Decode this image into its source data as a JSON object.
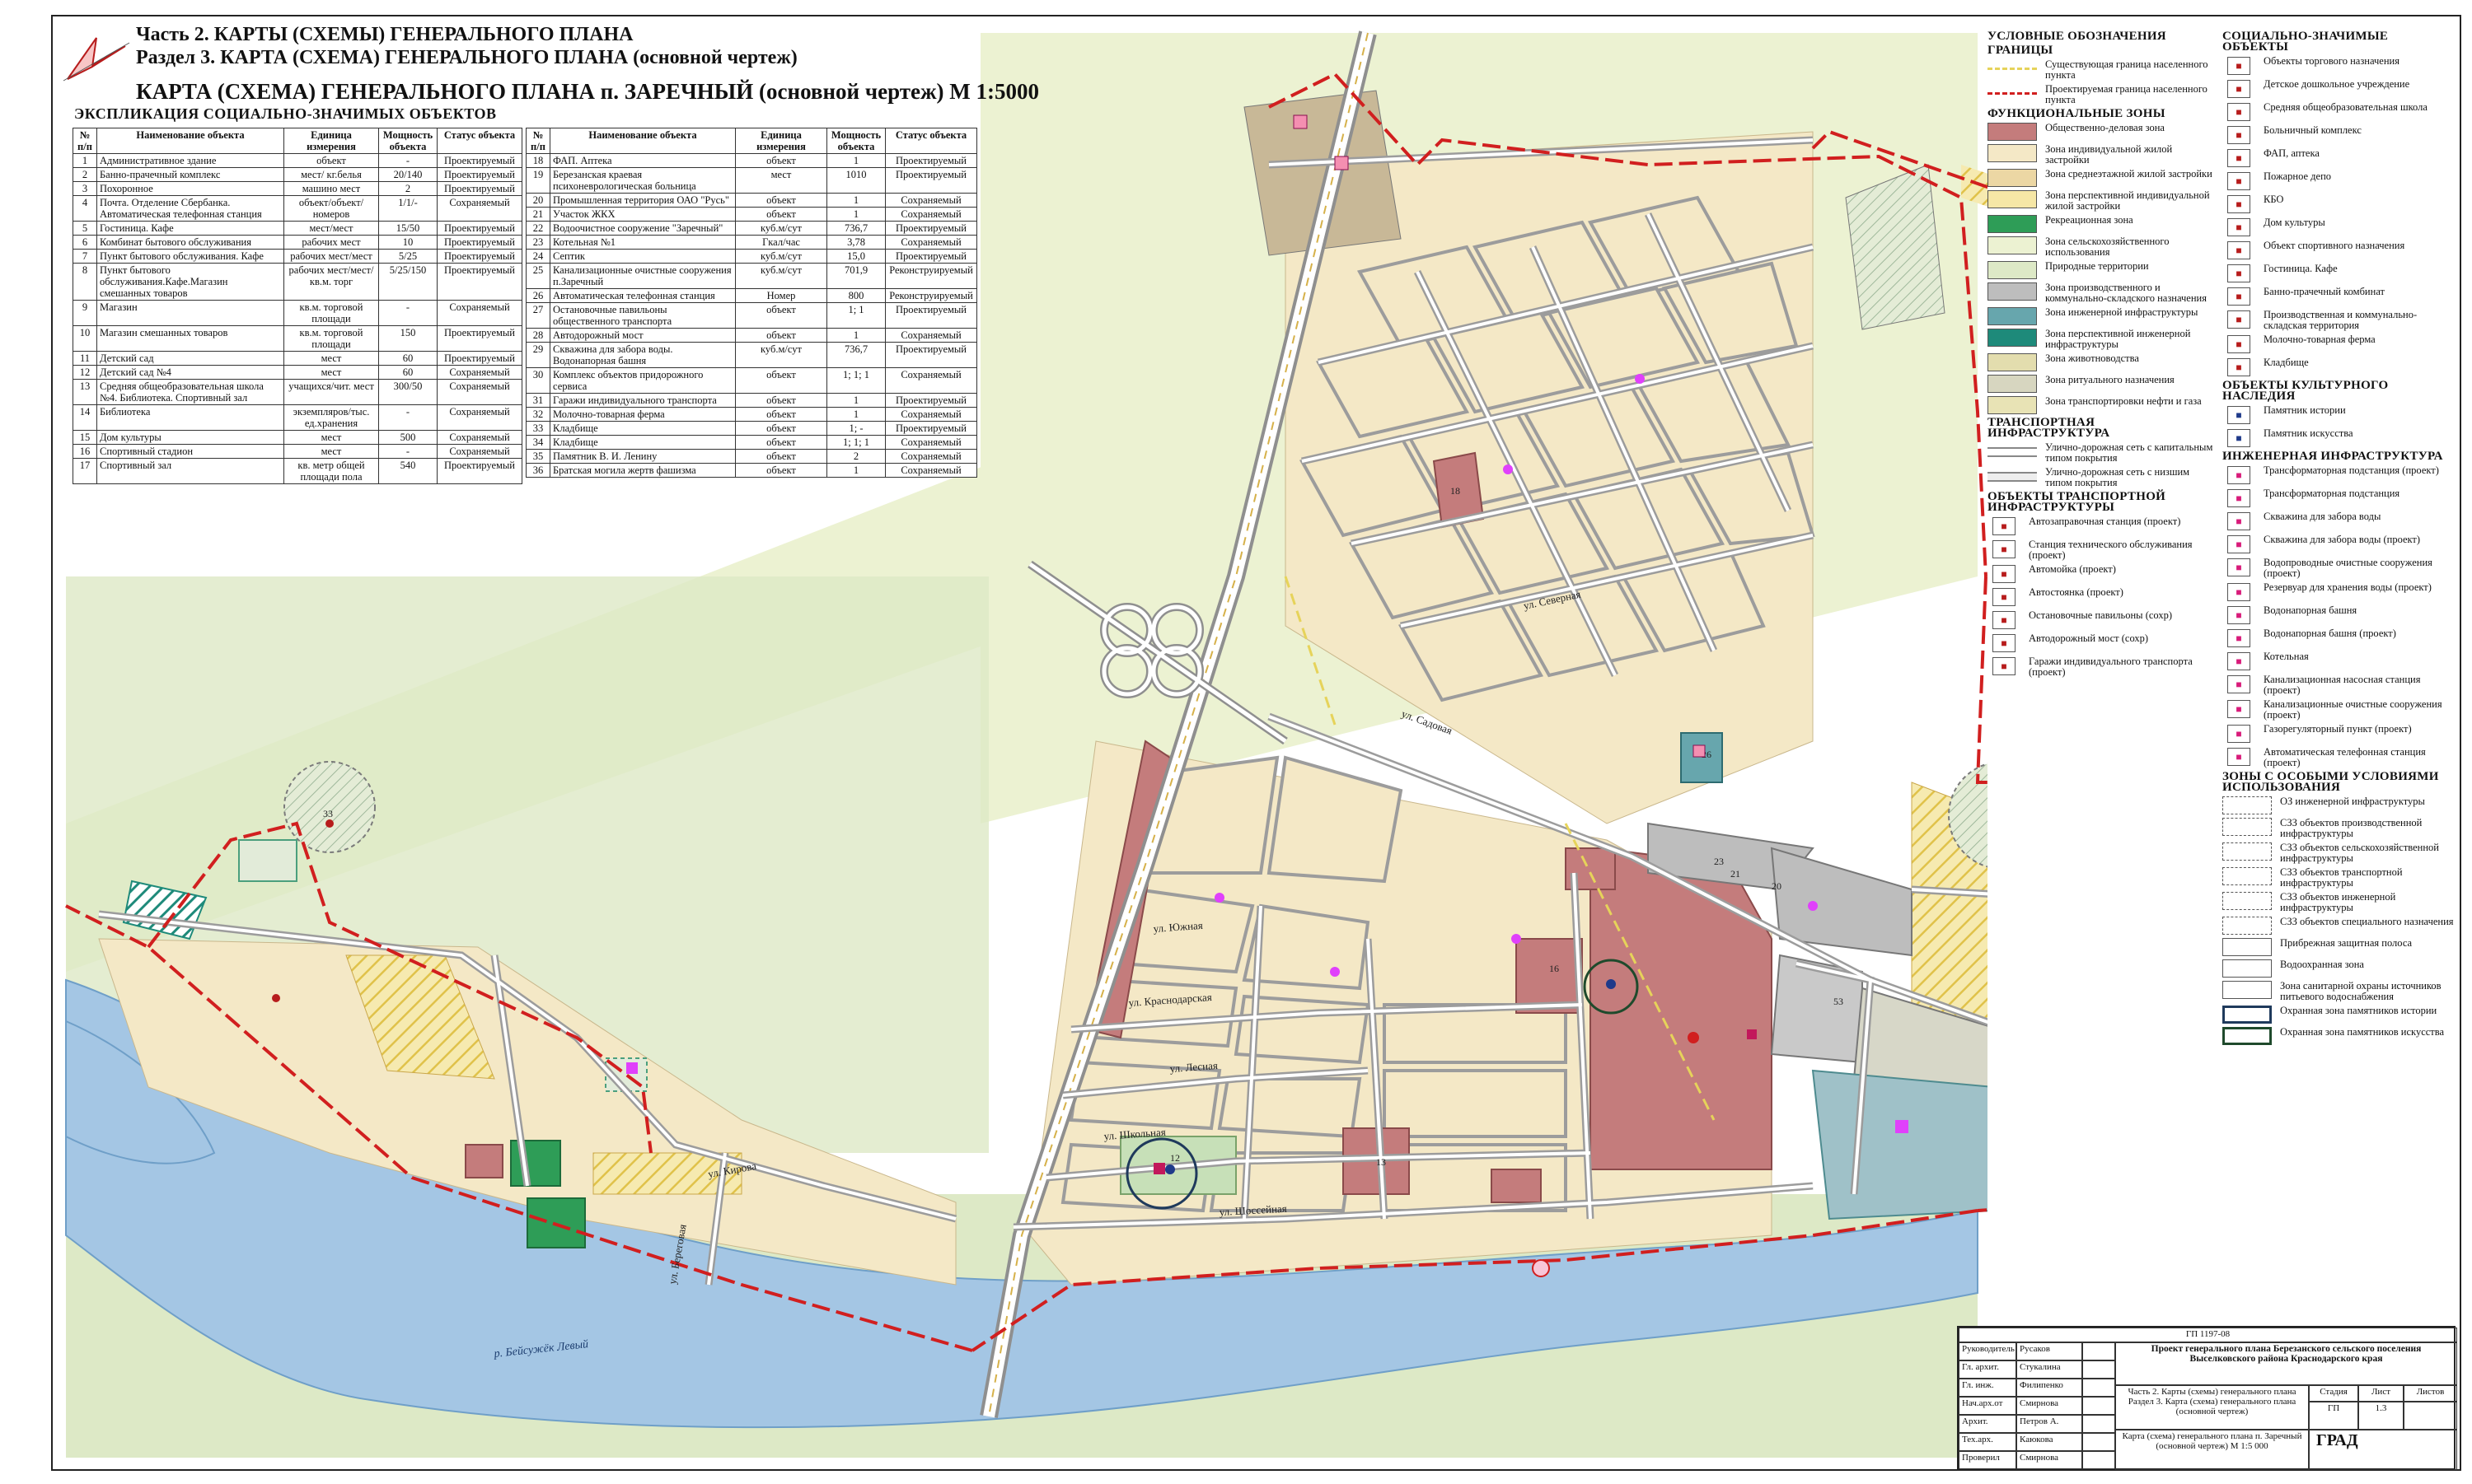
{
  "titles": {
    "part": "Часть 2. КАРТЫ (СХЕМЫ) ГЕНЕРАЛЬНОГО ПЛАНА",
    "section": "Раздел 3. КАРТА (СХЕМА) ГЕНЕРАЛЬНОГО ПЛАНА (основной чертеж)",
    "map": "КАРТА (СХЕМА) ГЕНЕРАЛЬНОГО ПЛАНА п. ЗАРЕЧНЫЙ (основной чертеж)  М 1:5000"
  },
  "explication": {
    "title": "ЭКСПЛИКАЦИЯ СОЦИАЛЬНО-ЗНАЧИМЫХ ОБЪЕКТОВ",
    "headers": [
      "№ п/п",
      "Наименование объекта",
      "Единица измерения",
      "Мощность объекта",
      "Статус объекта"
    ],
    "rows_left": [
      [
        "1",
        "Административное здание",
        "объект",
        "-",
        "Проектируемый"
      ],
      [
        "2",
        "Банно-прачечный комплекс",
        "мест/ кг.белья",
        "20/140",
        "Проектируемый"
      ],
      [
        "3",
        "Похоронное",
        "машино мест",
        "2",
        "Проектируемый"
      ],
      [
        "4",
        "Почта. Отделение Сбербанка. Автоматическая телефонная станция",
        "объект/объект/номеров",
        "1/1/-",
        "Сохраняемый"
      ],
      [
        "5",
        "Гостиница. Кафе",
        "мест/мест",
        "15/50",
        "Проектируемый"
      ],
      [
        "6",
        "Комбинат бытового обслуживания",
        "рабочих мест",
        "10",
        "Проектируемый"
      ],
      [
        "7",
        "Пункт бытового обслуживания. Кафе",
        "рабочих мест/мест",
        "5/25",
        "Проектируемый"
      ],
      [
        "8",
        "Пункт бытового обслуживания.Кафе.Магазин смешанных товаров",
        "рабочих мест/мест/кв.м. торг",
        "5/25/150",
        "Проектируемый"
      ],
      [
        "9",
        "Магазин",
        "кв.м. торговой площади",
        "-",
        "Сохраняемый"
      ],
      [
        "10",
        "Магазин смешанных товаров",
        "кв.м. торговой площади",
        "150",
        "Проектируемый"
      ],
      [
        "11",
        "Детский сад",
        "мест",
        "60",
        "Проектируемый"
      ],
      [
        "12",
        "Детский сад №4",
        "мест",
        "60",
        "Сохраняемый"
      ],
      [
        "13",
        "Средняя общеобразовательная школа №4. Библиотека. Спортивный зал",
        "учащихся/чит. мест",
        "300/50",
        "Сохраняемый"
      ],
      [
        "14",
        "Библиотека",
        "экземпляров/тыс. ед.хранения",
        "-",
        "Сохраняемый"
      ],
      [
        "15",
        "Дом культуры",
        "мест",
        "500",
        "Сохраняемый"
      ],
      [
        "16",
        "Спортивный стадион",
        "мест",
        "-",
        "Сохраняемый"
      ],
      [
        "17",
        "Спортивный зал",
        "кв. метр общей площади пола",
        "540",
        "Проектируемый"
      ]
    ],
    "rows_right": [
      [
        "18",
        "ФАП. Аптека",
        "объект",
        "1",
        "Проектируемый"
      ],
      [
        "19",
        "Березанская краевая психоневрологическая больница",
        "мест",
        "1010",
        "Проектируемый"
      ],
      [
        "20",
        "Промышленная территория ОАО \"Русь\"",
        "объект",
        "1",
        "Сохраняемый"
      ],
      [
        "21",
        "Участок ЖКХ",
        "объект",
        "1",
        "Сохраняемый"
      ],
      [
        "22",
        "Водоочистное сооружение \"Заречный\"",
        "куб.м/сут",
        "736,7",
        "Проектируемый"
      ],
      [
        "23",
        "Котельная №1",
        "Гкал/час",
        "3,78",
        "Сохраняемый"
      ],
      [
        "24",
        "Септик",
        "куб.м/сут",
        "15,0",
        "Проектируемый"
      ],
      [
        "25",
        "Канализационные очистные сооружения п.Заречный",
        "куб.м/сут",
        "701,9",
        "Реконструируемый"
      ],
      [
        "26",
        "Автоматическая телефонная станция",
        "Номер",
        "800",
        "Реконструируемый"
      ],
      [
        "27",
        "Остановочные павильоны общественного транспорта",
        "объект",
        "1; 1",
        "Проектируемый"
      ],
      [
        "28",
        "Автодорожный мост",
        "объект",
        "1",
        "Сохраняемый"
      ],
      [
        "29",
        "Скважина для забора воды. Водонапорная башня",
        "куб.м/сут",
        "736,7",
        "Проектируемый"
      ],
      [
        "30",
        "Комплекс объектов придорожного сервиса",
        "объект",
        "1; 1; 1",
        "Сохраняемый"
      ],
      [
        "31",
        "Гаражи индивидуального транспорта",
        "объект",
        "1",
        "Проектируемый"
      ],
      [
        "32",
        "Молочно-товарная ферма",
        "объект",
        "1",
        "Сохраняемый"
      ],
      [
        "33",
        "Кладбище",
        "объект",
        "1; -",
        "Проектируемый"
      ],
      [
        "34",
        "Кладбище",
        "объект",
        "1; 1; 1",
        "Сохраняемый"
      ],
      [
        "35",
        "Памятник В. И. Ленину",
        "объект",
        "2",
        "Сохраняемый"
      ],
      [
        "36",
        "Братская могила жертв фашизма",
        "объект",
        "1",
        "Сохраняемый"
      ]
    ]
  },
  "map": {
    "river_label": "р. Бейсужёк Левый",
    "streets": [
      "ул. Южная",
      "ул. Краснодарская",
      "ул. Лесная",
      "ул. Школьная",
      "ул. Садовая",
      "ул. Шоссейная",
      "ул. Кирова",
      "ул. Береговая",
      "ул. Северная"
    ],
    "lot_numbers": [
      "33",
      "53",
      "52",
      "23",
      "21",
      "20",
      "19",
      "16",
      "13",
      "12",
      "18",
      "26"
    ],
    "colors": {
      "residential": "#f4e8c6",
      "midrise": "#ecd7a4",
      "public": "#c47c7c",
      "agri": "#ecf2d2",
      "natural": "#dde9c6",
      "water": "#a4c6e4",
      "production": "#bdbdbd",
      "boundary": "#d11f1f",
      "recreation": "#2e9d57",
      "engineering": "#67a6ad"
    }
  },
  "legend": {
    "title": "УСЛОВНЫЕ ОБОЗНАЧЕНИЯ",
    "boundaries_title": "ГРАНИЦЫ",
    "boundaries": [
      {
        "label": "Существующая граница населенного пункта",
        "color": "#e6d35a"
      },
      {
        "label": "Проектируемая граница населенного пункта",
        "color": "#d11f1f"
      }
    ],
    "zones_title": "ФУНКЦИОНАЛЬНЫЕ ЗОНЫ",
    "zones": [
      {
        "label": "Общественно-деловая зона",
        "color": "#c47c7c"
      },
      {
        "label": "Зона индивидуальной жилой застройки",
        "color": "#f4e8c6"
      },
      {
        "label": "Зона среднеэтажной жилой застройки",
        "color": "#ecd7a4"
      },
      {
        "label": "Зона перспективной индивидуальной жилой застройки",
        "color": "#f6e7a6"
      },
      {
        "label": "Рекреационная зона",
        "color": "#2e9d57"
      },
      {
        "label": "Зона сельскохозяйственного использования",
        "color": "#ecf2d2"
      },
      {
        "label": "Природные территории",
        "color": "#dde9c6"
      },
      {
        "label": "Зона производственного и коммунально-складского назначения",
        "color": "#bdbdbd"
      },
      {
        "label": "Зона инженерной инфраструктуры",
        "color": "#67a6ad"
      },
      {
        "label": "Зона перспективной инженерной инфраструктуры",
        "color": "#1e8a7a"
      },
      {
        "label": "Зона животноводства",
        "color": "#e3ddae"
      },
      {
        "label": "Зона ритуального назначения",
        "color": "#d7d6c0"
      },
      {
        "label": "Зона транспортировки нефти и газа",
        "color": "#e8e3b5"
      }
    ],
    "transport_title": "ТРАНСПОРТНАЯ ИНФРАСТРУКТУРА",
    "transport": [
      {
        "label": "Улично-дорожная сеть с капитальным типом покрытия"
      },
      {
        "label": "Улично-дорожная сеть с низшим типом покрытия"
      }
    ],
    "transport_objects_title": "ОБЪЕКТЫ ТРАНСПОРТНОЙ ИНФРАСТРУКТУРЫ",
    "transport_objects": [
      "Автозаправочная станция (проект)",
      "Станция технического обслуживания (проект)",
      "Автомойка (проект)",
      "Автостоянка (проект)",
      "Остановочные павильоны (сохр)",
      "Автодорожный мост (сохр)",
      "Гаражи индивидуального транспорта (проект)"
    ],
    "social_title": "СОЦИАЛЬНО-ЗНАЧИМЫЕ ОБЪЕКТЫ",
    "social": [
      "Объекты торгового назначения",
      "Детское дошкольное учреждение",
      "Средняя общеобразовательная школа",
      "Больничный комплекс",
      "ФАП, аптека",
      "Пожарное депо",
      "КБО",
      "Дом культуры",
      "Объект спортивного назначения",
      "Гостиница. Кафе",
      "Банно-прачечный комбинат",
      "Производственная и коммунально-складская территория",
      "Молочно-товарная ферма",
      "Кладбище"
    ],
    "heritage_title": "ОБЪЕКТЫ КУЛЬТУРНОГО НАСЛЕДИЯ",
    "heritage": [
      "Памятник истории",
      "Памятник искусства"
    ],
    "engineering_title": "ИНЖЕНЕРНАЯ ИНФРАСТРУКТУРА",
    "engineering": [
      "Трансформаторная подстанция (проект)",
      "Трансформаторная подстанция",
      "Скважина для забора воды",
      "Скважина для забора воды (проект)",
      "Водопроводные очистные сооружения (проект)",
      "Резервуар для хранения воды (проект)",
      "Водонапорная башня",
      "Водонапорная башня (проект)",
      "Котельная",
      "Канализационная насосная станция (проект)",
      "Канализационные очистные сооружения (проект)",
      "Газорегуляторный пункт (проект)",
      "Автоматическая телефонная станция (проект)"
    ],
    "special_title": "ЗОНЫ С ОСОБЫМИ УСЛОВИЯМИ ИСПОЛЬЗОВАНИЯ",
    "special": [
      "ОЗ инженерной инфраструктуры",
      "СЗЗ объектов производственной инфраструктуры",
      "СЗЗ объектов сельскохозяйственной инфраструктуры",
      "СЗЗ объектов транспортной инфраструктуры",
      "СЗЗ объектов инженерной инфраструктуры",
      "СЗЗ объектов специального назначения",
      "Прибрежная защитная полоса",
      "Водоохранная зона",
      "Зона санитарной охраны источников питьевого водоснабжения",
      "Охранная зона памятников истории",
      "Охранная зона памятников искусства"
    ]
  },
  "stamp": {
    "code": "ГП 1197-08",
    "project": "Проект генерального плана Березанского сельского поселения Выселковского района Краснодарского края",
    "part": "Часть 2. Карты (схемы) генерального плана Раздел 3. Карта (схема) генерального плана (основной чертеж)",
    "sheet_title": "Карта (схема) генерального плана п. Заречный (основной чертеж)  М 1:5 000",
    "stage_label": "Стадия",
    "sheet_label": "Лист",
    "sheets_label": "Листов",
    "stage": "ГП",
    "sheet": "1.3",
    "sheets": "",
    "org": "ГРАД",
    "roles": [
      [
        "Руководитель",
        "Русаков"
      ],
      [
        "Гл. архит.",
        "Стукалина"
      ],
      [
        "Гл. инж.",
        "Филипенко"
      ],
      [
        "Нач.арх.от",
        "Смирнова"
      ],
      [
        "Архит.",
        "Петров А."
      ],
      [
        "Тех.арх.",
        "Каюкова"
      ],
      [
        "Проверил",
        "Смирнова"
      ]
    ]
  }
}
